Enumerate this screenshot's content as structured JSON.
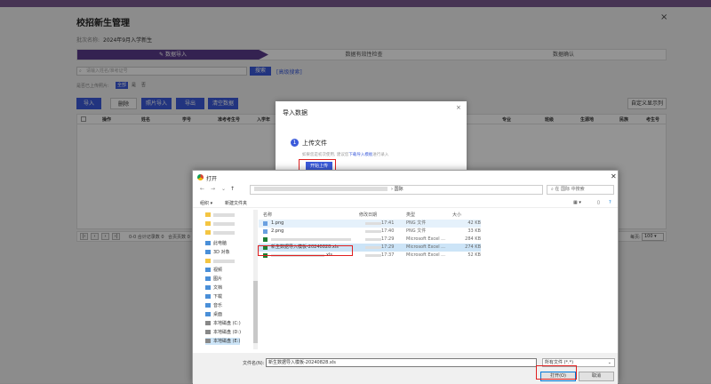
{
  "page": {
    "title": "校招新生管理",
    "close_glyph": "×",
    "batch_label": "批次名称:",
    "batch_value": "2024年9月入学新生"
  },
  "steps": [
    "数据导入",
    "数据有效性检查",
    "数据确认"
  ],
  "search": {
    "placeholder": "请输入姓名/准考证号",
    "button": "搜索",
    "advanced": "[高级搜索]"
  },
  "filter": {
    "label": "是否已上传照片:",
    "options": [
      "全部",
      "是",
      "否"
    ]
  },
  "toolbar": {
    "import": "导入",
    "delete": "删除",
    "photo_import": "照片导入",
    "export": "导出",
    "clear": "清空数据",
    "custom_columns": "自定义显示列"
  },
  "table": {
    "headers": [
      "操作",
      "姓名",
      "学号",
      "准考考生号",
      "入学年",
      "专业",
      "班级",
      "生源地",
      "民族",
      "考生号"
    ]
  },
  "pager": {
    "summary": "0-0 合计记录数 0",
    "pages": "合页页数 0",
    "per_page_label": "每页:",
    "per_page": "100"
  },
  "import_modal": {
    "title": "导入数据",
    "close": "×",
    "step_num": "1",
    "step_title": "上传文件",
    "hint_prefix": "如果您是初次使用, 建议您",
    "hint_link": "下载导入模板",
    "hint_suffix": "进行录入",
    "upload_button": "开始上传"
  },
  "open_dialog": {
    "title": "打开",
    "close": "✕",
    "path_last": "国际",
    "search_placeholder": "在 国际 中搜索",
    "organize": "组织 ▾",
    "new_folder": "新建文件夹",
    "sidebar": [
      "此电脑",
      "3D 对象",
      "视频",
      "图片",
      "文档",
      "下载",
      "音乐",
      "桌面",
      "本地磁盘 (C:)",
      "本地磁盘 (D:)",
      "本地磁盘 (E:)"
    ],
    "columns": {
      "name": "名称",
      "date": "修改日期",
      "type": "类型",
      "size": "大小"
    },
    "files": [
      {
        "name": "1.png",
        "date": "17:41",
        "type": "PNG 文件",
        "size": "42 KB",
        "kind": "png"
      },
      {
        "name": "2.png",
        "date": "17:40",
        "type": "PNG 文件",
        "size": "33 KB",
        "kind": "png"
      },
      {
        "name": "",
        "date": "17:29",
        "type": "Microsoft Excel ...",
        "size": "284 KB",
        "kind": "xls"
      },
      {
        "name": "新生数据导入模板-20240828.xls",
        "date": "17:29",
        "type": "Microsoft Excel ...",
        "size": "274 KB",
        "kind": "xls"
      },
      {
        "name": "xls",
        "date": "17:37",
        "type": "Microsoft Excel ...",
        "size": "52 KB",
        "kind": "xls"
      }
    ],
    "filename_label": "文件名(N):",
    "filename_value": "新生数据导入模板-20240828.xls",
    "filetype": "所有文件 (*.*)",
    "open_button": "打开(O)",
    "cancel_button": "取消"
  }
}
